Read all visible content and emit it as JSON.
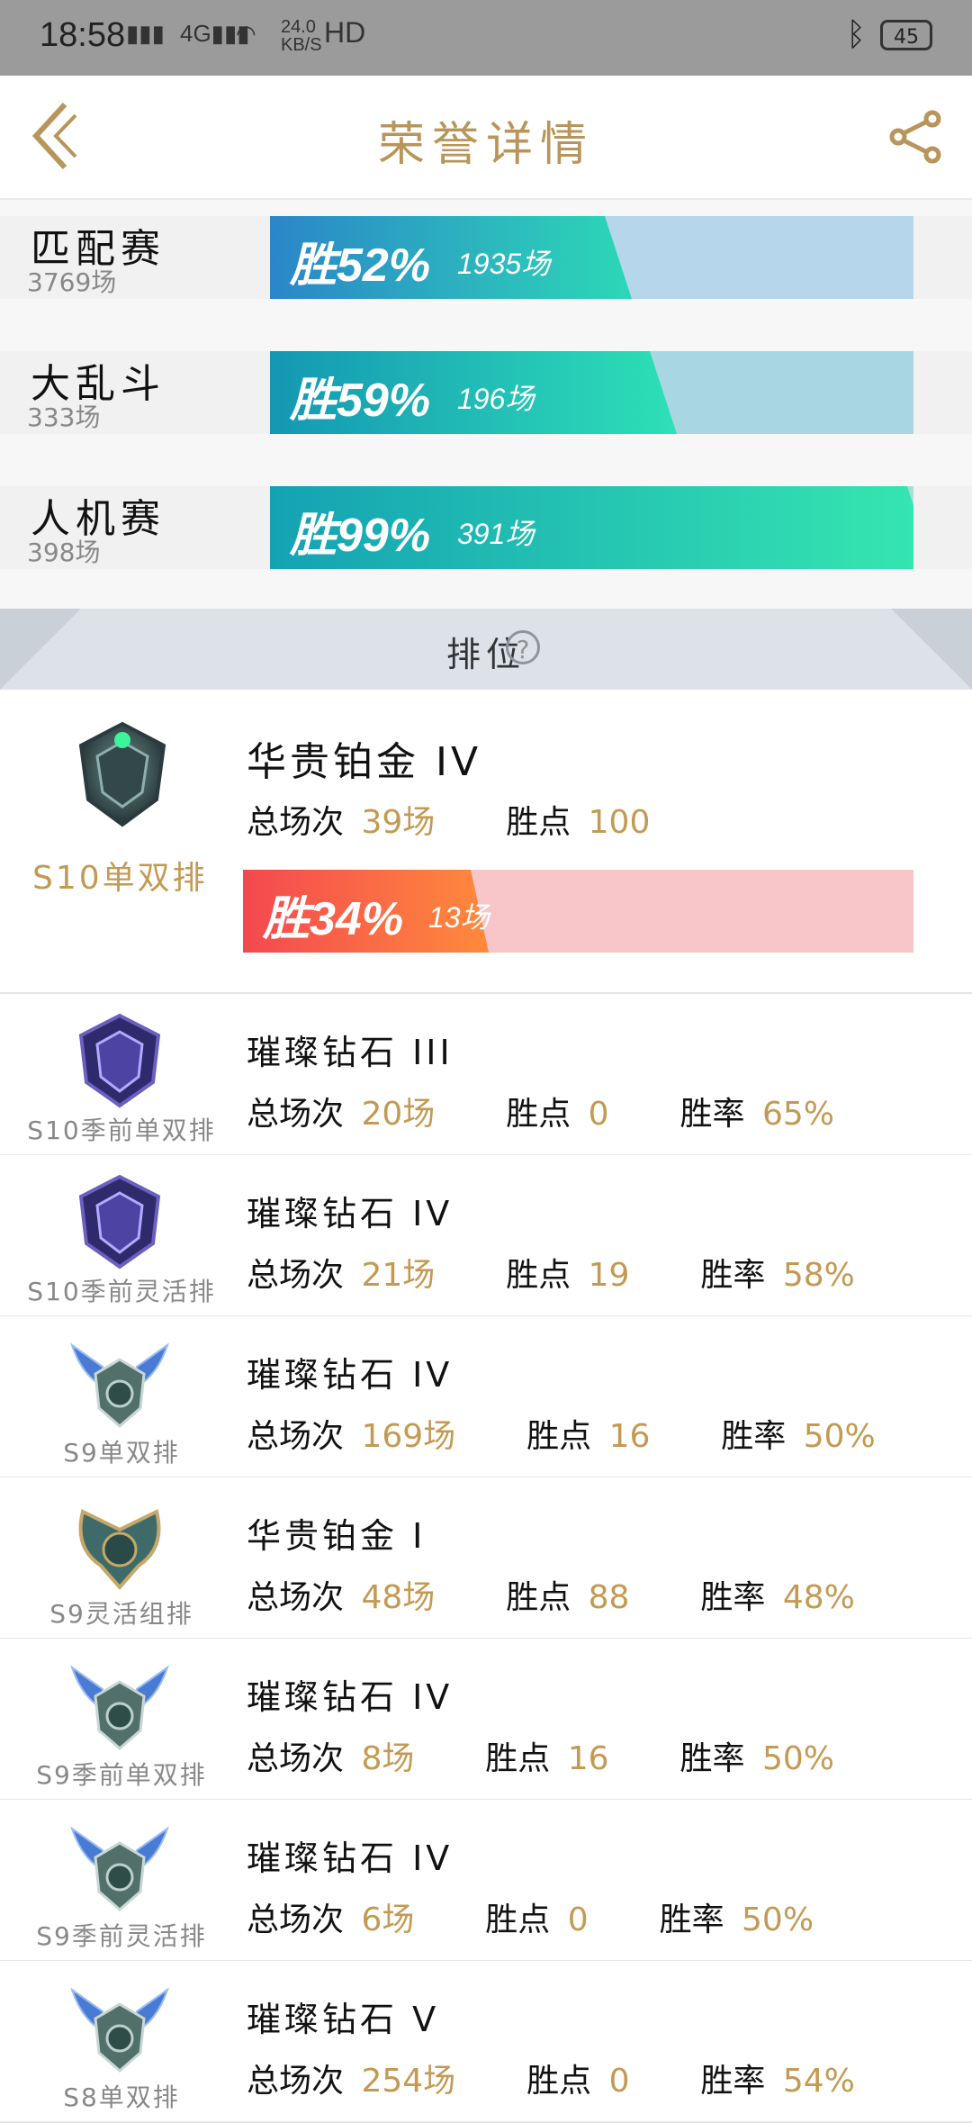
{
  "status_bar": {
    "time": "18:58",
    "network_speed": "24.0",
    "network_unit": "KB/S",
    "hd": "HD",
    "battery": "45"
  },
  "header": {
    "title": "荣誉详情"
  },
  "modes": [
    {
      "name": "匹配赛",
      "count": "3769场",
      "win": "胜52%",
      "games": "1935场",
      "win_rate": 52,
      "bar_bg": "#b6d6ec",
      "fill_from": "#2b86c9",
      "fill_to": "#2cd8b6"
    },
    {
      "name": "大乱斗",
      "count": "333场",
      "win": "胜59%",
      "games": "196场",
      "win_rate": 59,
      "bar_bg": "#a9d6e3",
      "fill_from": "#1497b3",
      "fill_to": "#2ee0b7"
    },
    {
      "name": "人机赛",
      "count": "398场",
      "win": "胜99%",
      "games": "391场",
      "win_rate": 99,
      "bar_bg": "#a8e0d8",
      "fill_from": "#14a2b3",
      "fill_to": "#36e8b0"
    }
  ],
  "ranked": {
    "label": "排位",
    "help": "?"
  },
  "current_rank": {
    "season": "S10单双排",
    "rank": "华贵铂金 IV",
    "total_label": "总场次",
    "total": "39场",
    "points_label": "胜点",
    "points": "100",
    "win": "胜34%",
    "games": "13场",
    "win_rate": 34
  },
  "history": [
    {
      "season": "S10季前单双排",
      "rank": "璀璨钻石 III",
      "total": "20场",
      "points": "0",
      "rate": "65%",
      "tier": "diamond"
    },
    {
      "season": "S10季前灵活排",
      "rank": "璀璨钻石 IV",
      "total": "21场",
      "points": "19",
      "rate": "58%",
      "tier": "diamond"
    },
    {
      "season": "S9单双排",
      "rank": "璀璨钻石 IV",
      "total": "169场",
      "points": "16",
      "rate": "50%",
      "tier": "diamond-winged"
    },
    {
      "season": "S9灵活组排",
      "rank": "华贵铂金 I",
      "total": "48场",
      "points": "88",
      "rate": "48%",
      "tier": "platinum"
    },
    {
      "season": "S9季前单双排",
      "rank": "璀璨钻石 IV",
      "total": "8场",
      "points": "16",
      "rate": "50%",
      "tier": "diamond-winged"
    },
    {
      "season": "S9季前灵活排",
      "rank": "璀璨钻石 IV",
      "total": "6场",
      "points": "0",
      "rate": "50%",
      "tier": "diamond-winged"
    },
    {
      "season": "S8单双排",
      "rank": "璀璨钻石 V",
      "total": "254场",
      "points": "0",
      "rate": "54%",
      "tier": "diamond-winged"
    }
  ],
  "labels": {
    "total": "总场次",
    "points": "胜点",
    "rate": "胜率"
  },
  "colors": {
    "accent_gold": "#c39a53",
    "current_bar_bg": "#f8c5c8",
    "current_fill_from": "#f4484f",
    "current_fill_to": "#ff8a3c"
  }
}
